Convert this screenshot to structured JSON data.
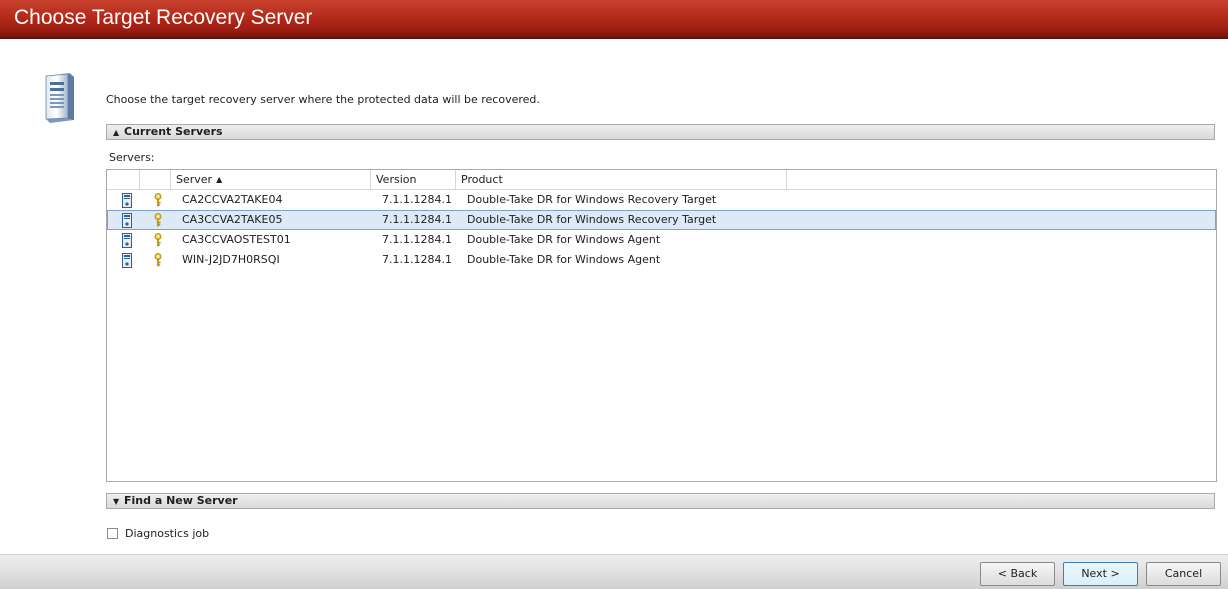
{
  "window": {
    "title": "Choose Target Recovery Server"
  },
  "intro_text": "Choose the target recovery server where the protected data will be recovered.",
  "current_servers": {
    "label": "Current Servers",
    "expanded": true,
    "servers_label": "Servers:",
    "columns": {
      "server": "Server",
      "version": "Version",
      "product": "Product"
    },
    "sort_indicator": "▲",
    "rows": [
      {
        "server": "CA2CCVA2TAKE04",
        "version": "7.1.1.1284.1",
        "product": "Double-Take DR for Windows Recovery Target",
        "selected": false
      },
      {
        "server": "CA3CCVA2TAKE05",
        "version": "7.1.1.1284.1",
        "product": "Double-Take DR for Windows Recovery Target",
        "selected": true
      },
      {
        "server": "CA3CCVAOSTEST01",
        "version": "7.1.1.1284.1",
        "product": "Double-Take DR for Windows Agent",
        "selected": false
      },
      {
        "server": "WIN-J2JD7H0RSQI",
        "version": "7.1.1.1284.1",
        "product": "Double-Take DR for Windows Agent",
        "selected": false
      }
    ]
  },
  "find_new_server": {
    "label": "Find a New Server",
    "expanded": false
  },
  "diagnostics": {
    "label": "Diagnostics job",
    "checked": false
  },
  "buttons": {
    "back": "< Back",
    "next": "Next >",
    "cancel": "Cancel"
  },
  "colors": {
    "title_bar": "#b52a1a",
    "selection": "#dde9f7",
    "selection_border": "#7da2ce"
  },
  "icons": {
    "hero": "server-tower-icon",
    "row_server": "server-icon",
    "row_key": "key-icon"
  }
}
